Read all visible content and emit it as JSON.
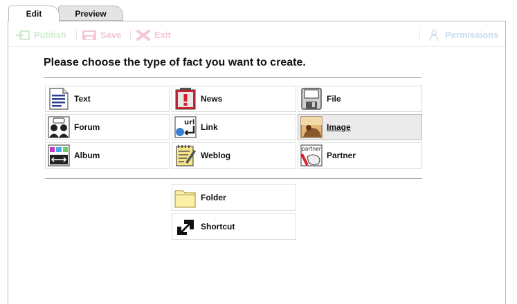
{
  "tabs": [
    {
      "label": "Edit",
      "active": true
    },
    {
      "label": "Preview",
      "active": false
    }
  ],
  "toolbar": {
    "publish_label": "Publish",
    "save_label": "Save",
    "exit_label": "Exit",
    "permissions_label": "Permissions"
  },
  "main": {
    "heading": "Please choose the type of fact you want to create.",
    "types": [
      {
        "label": "Text",
        "icon": "text-document-icon"
      },
      {
        "label": "News",
        "icon": "news-alert-icon"
      },
      {
        "label": "File",
        "icon": "floppy-disk-icon"
      },
      {
        "label": "Forum",
        "icon": "forum-people-icon"
      },
      {
        "label": "Link",
        "icon": "url-link-icon"
      },
      {
        "label": "Image",
        "icon": "image-photo-icon",
        "selected": true
      },
      {
        "label": "Album",
        "icon": "album-icon"
      },
      {
        "label": "Weblog",
        "icon": "weblog-notepad-icon"
      },
      {
        "label": "Partner",
        "icon": "partner-handshake-icon"
      }
    ],
    "extra_types": [
      {
        "label": "Folder",
        "icon": "folder-icon"
      },
      {
        "label": "Shortcut",
        "icon": "shortcut-arrow-icon"
      }
    ]
  },
  "colors": {
    "selected_background": "#ebebeb",
    "border": "#dcdcdc",
    "publish_disabled": "#cfeccf",
    "save_disabled": "#f4c8d4",
    "permissions_disabled": "#c8dcf0"
  }
}
